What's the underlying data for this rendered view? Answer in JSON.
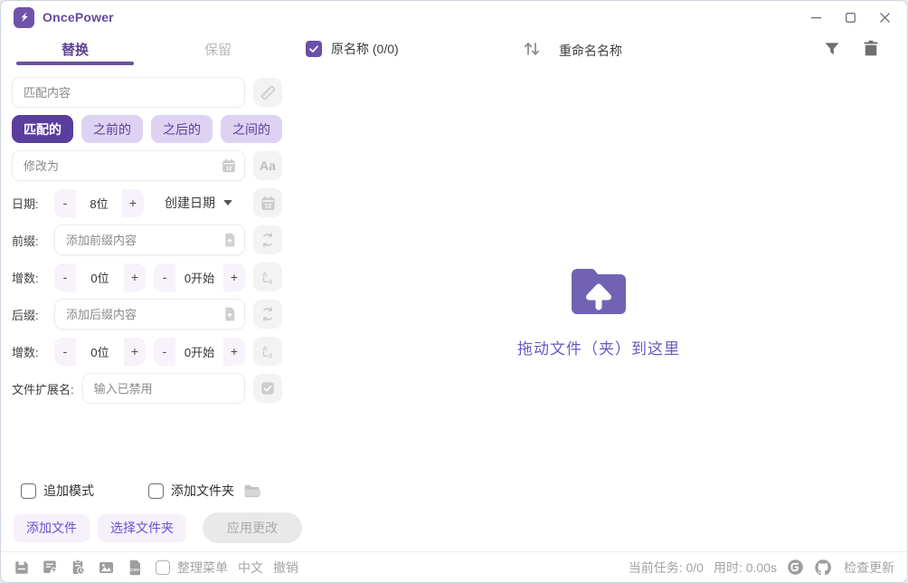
{
  "window": {
    "app_title": "OncePower"
  },
  "header": {
    "tabs": [
      {
        "label": "替换",
        "active": true
      },
      {
        "label": "保留",
        "active": false
      }
    ],
    "select_all_label": "原名称 (0/0)",
    "rename_column_label": "重命名名称"
  },
  "panel": {
    "match_placeholder": "匹配内容",
    "mode_buttons": [
      {
        "label": "匹配的",
        "active": true
      },
      {
        "label": "之前的",
        "active": false
      },
      {
        "label": "之后的",
        "active": false
      },
      {
        "label": "之间的",
        "active": false
      }
    ],
    "replace_placeholder": "修改为",
    "aa_label": "Aa",
    "minus": "-",
    "plus": "+",
    "calendar_day": "12",
    "date": {
      "label": "日期:",
      "digits": "8位",
      "type": "创建日期"
    },
    "prefix": {
      "label": "前缀:",
      "placeholder": "添加前缀内容"
    },
    "inc1": {
      "label": "增数:",
      "digits": "0位",
      "start": "0开始"
    },
    "suffix": {
      "label": "后缀:",
      "placeholder": "添加后缀内容"
    },
    "inc2": {
      "label": "增数:",
      "digits": "0位",
      "start": "0开始"
    },
    "ext": {
      "label": "文件扩展名:",
      "placeholder": "输入已禁用"
    }
  },
  "dropzone": {
    "text": "拖动文件（夹）到这里"
  },
  "footer": {
    "append_mode_label": "追加模式",
    "add_folder_label": "添加文件夹",
    "add_files_button": "添加文件",
    "choose_folder_button": "选择文件夹",
    "apply_button": "应用更改"
  },
  "statusbar": {
    "organize_menu_label": "整理菜单",
    "language_label": "中文",
    "undo_label": "撤销",
    "current_task": "当前任务: 0/0",
    "elapsed": "用时: 0.00s",
    "check_update_label": "检查更新",
    "csv_label": "CSV",
    "gitee_label": "G"
  },
  "colors": {
    "primary": "#6b4fa8",
    "primary_deep": "#5b3d9e",
    "lavender": "#ddd2f2",
    "lavender_light": "#f8f2fa",
    "folder_purple": "#7262b4",
    "drop_text": "#6a59c4"
  }
}
